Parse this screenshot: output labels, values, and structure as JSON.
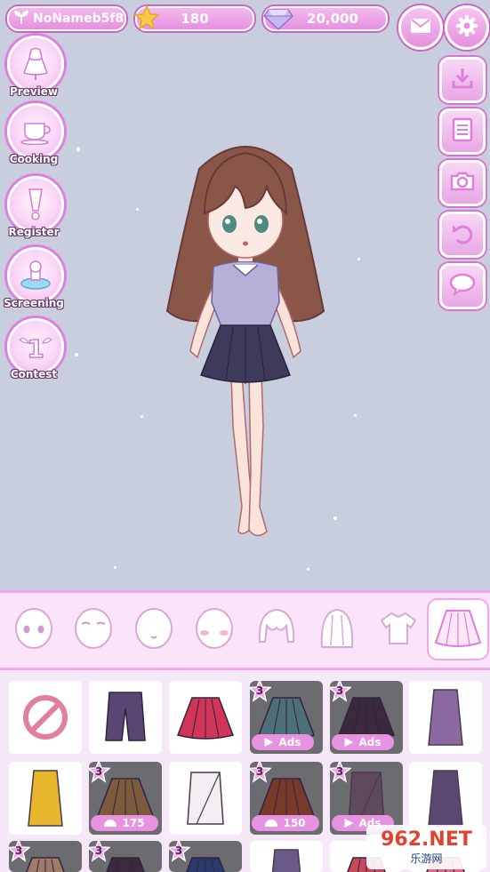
{
  "header": {
    "username": "NoNameb5f8",
    "stars": "180",
    "gems": "20,000"
  },
  "left_menu": [
    {
      "label": "Preview",
      "icon": "dress-form-icon"
    },
    {
      "label": "Cooking",
      "icon": "tea-cup-icon"
    },
    {
      "label": "Register",
      "icon": "exclamation-icon"
    },
    {
      "label": "Screening",
      "icon": "stamp-icon"
    },
    {
      "label": "Contest",
      "icon": "winged-one-badge-icon"
    }
  ],
  "right_tools": [
    "download-icon",
    "document-icon",
    "camera-icon",
    "undo-icon",
    "speech-bubble-icon"
  ],
  "categories": [
    {
      "name": "eyes",
      "icon": "face-eyes-icon"
    },
    {
      "name": "eyebrows",
      "icon": "face-brows-icon"
    },
    {
      "name": "mouth",
      "icon": "face-mouth-icon"
    },
    {
      "name": "blush",
      "icon": "face-blush-icon"
    },
    {
      "name": "bangs",
      "icon": "front-hair-icon"
    },
    {
      "name": "back hair",
      "icon": "back-hair-icon"
    },
    {
      "name": "tops",
      "icon": "shirt-icon"
    },
    {
      "name": "skirts",
      "icon": "skirt-icon",
      "selected": true
    }
  ],
  "items": [
    {
      "kind": "none",
      "color": "#e07fa0"
    },
    {
      "kind": "shorts",
      "color": "#5a4672"
    },
    {
      "kind": "skirt",
      "color": "#d23558"
    },
    {
      "kind": "skirt",
      "color": "#4f6f78",
      "badge": "3",
      "tag": "Ads"
    },
    {
      "kind": "skirt",
      "color": "#3a2a3c",
      "badge": "3",
      "tag": "Ads"
    },
    {
      "kind": "pencil",
      "color": "#8a6aa0"
    },
    {
      "kind": "pencil",
      "color": "#e8b62c"
    },
    {
      "kind": "skirt",
      "color": "#7d5a3c",
      "badge": "3",
      "price": "175"
    },
    {
      "kind": "wrap",
      "color": "#f1eef2"
    },
    {
      "kind": "skirt",
      "color": "#7a3a2a",
      "badge": "3",
      "price": "150"
    },
    {
      "kind": "wrap",
      "color": "#5e4a5a",
      "badge": "3",
      "tag": "Ads"
    },
    {
      "kind": "pencil",
      "color": "#5a4870"
    },
    {
      "kind": "skirt",
      "color": "#a07a68",
      "badge": "3"
    },
    {
      "kind": "skirt",
      "color": "#3a2a3c",
      "badge": "3"
    },
    {
      "kind": "skirt",
      "color": "#2a3a6a",
      "badge": "3"
    },
    {
      "kind": "pencil",
      "color": "#6a5a8a"
    },
    {
      "kind": "skirt",
      "color": "#c84a5a"
    },
    {
      "kind": "skirt",
      "color": "#e06a8a"
    }
  ],
  "watermark": {
    "brand": "962.NET",
    "sub": "乐游网"
  },
  "colors": {
    "accent": "#e690e0",
    "background": "#c9cedf",
    "panel": "#fbe3fa"
  }
}
